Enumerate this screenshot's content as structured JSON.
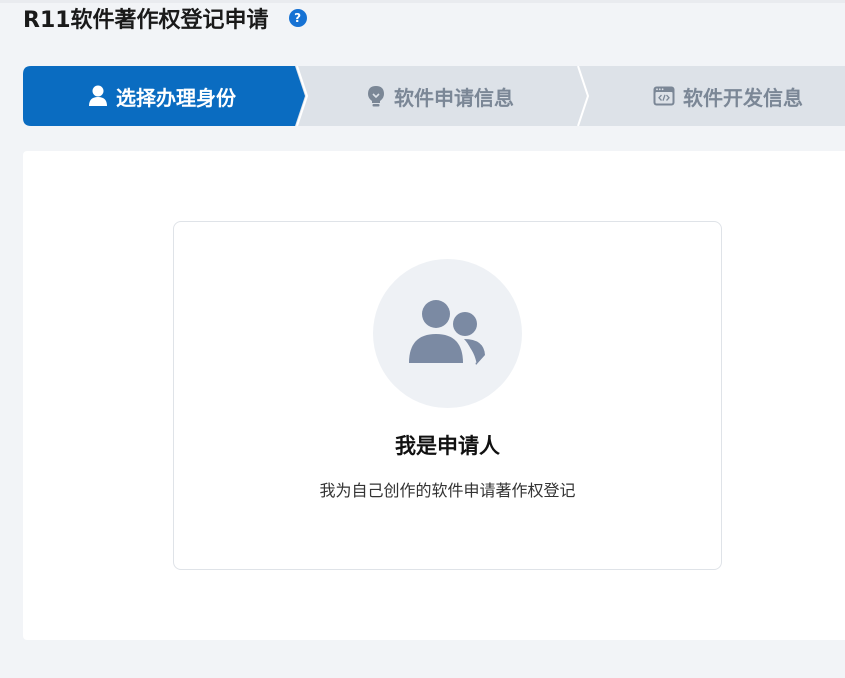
{
  "header": {
    "title": "R11软件著作权登记申请",
    "help_icon": "question-circle-icon",
    "help_glyph": "?"
  },
  "steps": [
    {
      "label": "选择办理身份",
      "icon": "user-icon",
      "state": "active"
    },
    {
      "label": "软件申请信息",
      "icon": "lightbulb-icon",
      "state": "inactive"
    },
    {
      "label": "软件开发信息",
      "icon": "code-window-icon",
      "state": "inactive"
    }
  ],
  "identity_card": {
    "icon": "users-icon",
    "title": "我是申请人",
    "description": "我为自己创作的软件申请著作权登记"
  },
  "colors": {
    "active_step": "#0a6cc1",
    "inactive_step": "#dde2e8",
    "inactive_text": "#7b8796",
    "help_icon": "#1672d4",
    "avatar_bg": "#eef1f5",
    "avatar_fg": "#7b8aa3",
    "page_bg": "#f2f4f7"
  }
}
